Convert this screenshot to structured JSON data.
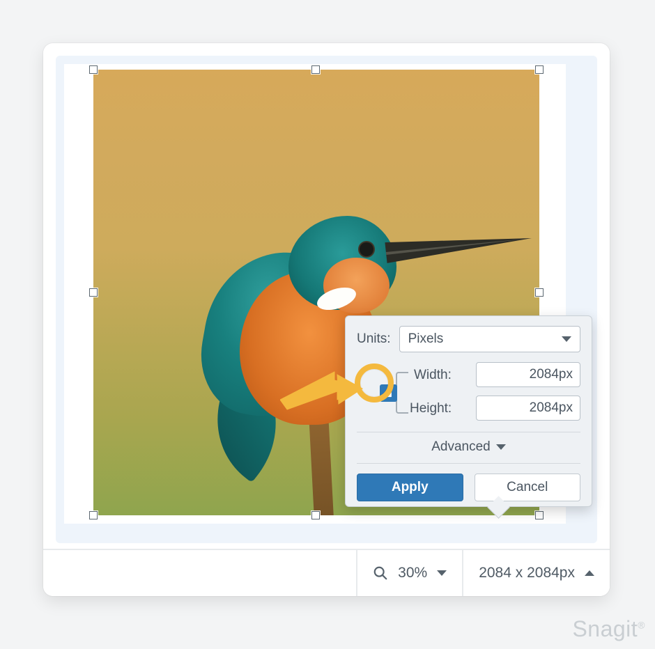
{
  "statusbar": {
    "zoom_label": "30%",
    "dimensions_label": "2084 x 2084px"
  },
  "popup": {
    "units_label": "Units:",
    "units_value": "Pixels",
    "width_label": "Width:",
    "width_value": "2084px",
    "height_label": "Height:",
    "height_value": "2084px",
    "advanced_label": "Advanced",
    "apply_label": "Apply",
    "cancel_label": "Cancel"
  },
  "brand": {
    "name": "Snagit",
    "mark": "®"
  },
  "icons": {
    "search": "search-icon",
    "lock": "lock-icon",
    "chevron_down": "chevron-down-icon",
    "chevron_up": "chevron-up-icon",
    "arrow": "annotation-arrow-icon",
    "circle": "annotation-circle-icon"
  },
  "annotation": {
    "arrow_color": "#f4b93e",
    "circle_color": "#f4b93e"
  }
}
